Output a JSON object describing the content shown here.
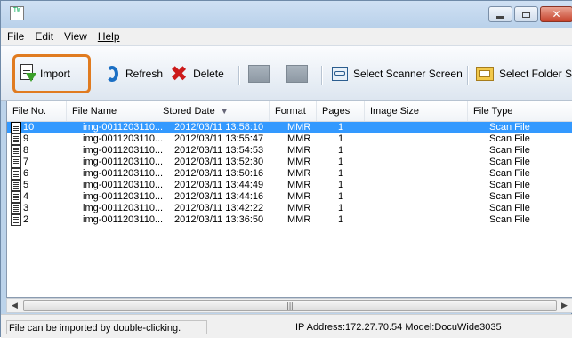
{
  "menu": {
    "items": [
      "File",
      "Edit",
      "View",
      "Help"
    ]
  },
  "toolbar": {
    "import_label": "Import",
    "refresh_label": "Refresh",
    "delete_label": "Delete",
    "scanner_label": "Select Scanner Screen",
    "folder_label": "Select Folder Sc"
  },
  "table": {
    "columns": [
      "File No.",
      "File Name",
      "Stored Date",
      "Format",
      "Pages",
      "Image Size",
      "File Type"
    ],
    "sort_indicator": "▼",
    "rows": [
      {
        "no": "10",
        "name": "img-0011203110...",
        "date": "2012/03/11 13:58:10",
        "format": "MMR",
        "pages": "1",
        "size": "",
        "type": "Scan File",
        "selected": true
      },
      {
        "no": "9",
        "name": "img-0011203110...",
        "date": "2012/03/11 13:55:47",
        "format": "MMR",
        "pages": "1",
        "size": "",
        "type": "Scan File"
      },
      {
        "no": "8",
        "name": "img-0011203110...",
        "date": "2012/03/11 13:54:53",
        "format": "MMR",
        "pages": "1",
        "size": "",
        "type": "Scan File"
      },
      {
        "no": "7",
        "name": "img-0011203110...",
        "date": "2012/03/11 13:52:30",
        "format": "MMR",
        "pages": "1",
        "size": "",
        "type": "Scan File"
      },
      {
        "no": "6",
        "name": "img-0011203110...",
        "date": "2012/03/11 13:50:16",
        "format": "MMR",
        "pages": "1",
        "size": "",
        "type": "Scan File"
      },
      {
        "no": "5",
        "name": "img-0011203110...",
        "date": "2012/03/11 13:44:49",
        "format": "MMR",
        "pages": "1",
        "size": "",
        "type": "Scan File"
      },
      {
        "no": "4",
        "name": "img-0011203110...",
        "date": "2012/03/11 13:44:16",
        "format": "MMR",
        "pages": "1",
        "size": "",
        "type": "Scan File"
      },
      {
        "no": "3",
        "name": "img-0011203110...",
        "date": "2012/03/11 13:42:22",
        "format": "MMR",
        "pages": "1",
        "size": "",
        "type": "Scan File"
      },
      {
        "no": "2",
        "name": "img-0011203110...",
        "date": "2012/03/11 13:36:50",
        "format": "MMR",
        "pages": "1",
        "size": "",
        "type": "Scan File"
      }
    ]
  },
  "status": {
    "hint": "File can be imported by double-clicking.",
    "info": "IP Address:172.27.70.54 Model:DocuWide3035"
  },
  "colors": {
    "highlight": "#e07b20",
    "selection": "#3399ff",
    "close_button": "#c7432c"
  }
}
